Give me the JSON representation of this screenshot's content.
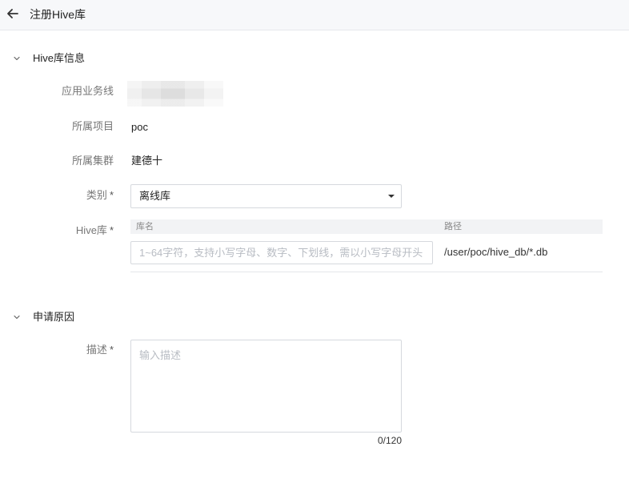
{
  "header": {
    "title": "注册Hive库"
  },
  "section_info": {
    "title": "Hive库信息",
    "fields": {
      "business_line": {
        "label": "应用业务线",
        "value": ""
      },
      "project": {
        "label": "所属项目",
        "value": "poc"
      },
      "cluster": {
        "label": "所属集群",
        "value": "建德十"
      },
      "category": {
        "label": "类别",
        "required_mark": "*",
        "selected": "离线库"
      },
      "hive_db": {
        "label": "Hive库",
        "required_mark": "*",
        "columns": {
          "name": "库名",
          "path": "路径"
        },
        "name_placeholder": "1~64字符，支持小写字母、数字、下划线，需以小写字母开头",
        "name_value": "",
        "path_value": "/user/poc/hive_db/*.db"
      }
    }
  },
  "section_reason": {
    "title": "申请原因",
    "description": {
      "label": "描述",
      "required_mark": "*",
      "placeholder": "输入描述",
      "value": "",
      "counter": "0/120"
    }
  },
  "icons": {
    "back": "arrow-left-icon",
    "collapse": "chevron-down-icon",
    "select_caret": "caret-down-icon"
  },
  "colors": {
    "header_bg": "#f7f8fa",
    "label": "#777777",
    "border": "#d6d9de"
  }
}
